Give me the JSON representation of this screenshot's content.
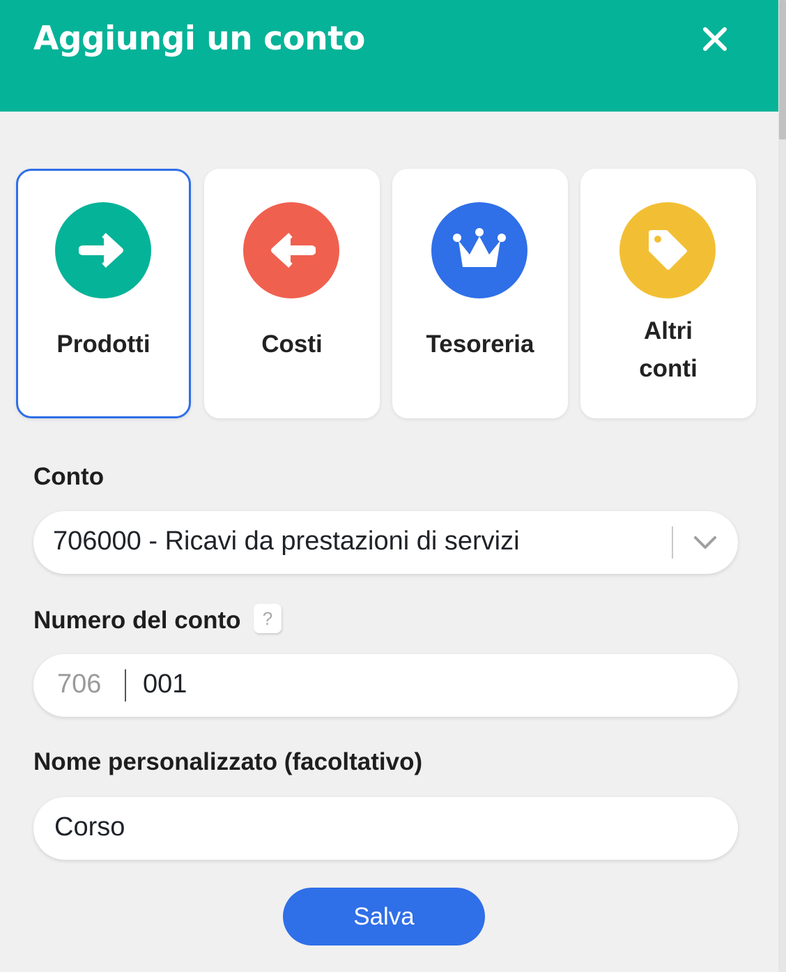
{
  "dialog": {
    "title": "Aggiungi un conto",
    "close_icon": "close-icon",
    "header_color": "#05b398"
  },
  "categories": [
    {
      "label": "Prodotti",
      "icon": "arrow-right-icon",
      "color": "#05b398",
      "selected": true
    },
    {
      "label": "Costi",
      "icon": "arrow-left-icon",
      "color": "#f0604f",
      "selected": false
    },
    {
      "label": "Tesoreria",
      "icon": "crown-icon",
      "color": "#2f6fe8",
      "selected": false
    },
    {
      "label_line1": "Altri",
      "label_line2": "conti",
      "icon": "tag-icon",
      "color": "#f2bf34",
      "selected": false
    }
  ],
  "form": {
    "account_label": "Conto",
    "account_value": "706000 - Ricavi da prestazioni di servizi",
    "number_label": "Numero del conto",
    "help_icon": "?",
    "number_prefix": "706",
    "number_value": "001",
    "custom_name_label": "Nome personalizzato (facoltativo)",
    "custom_name_value": "Corso"
  },
  "save_label": "Salva",
  "accent_color": "#2f6fe8"
}
